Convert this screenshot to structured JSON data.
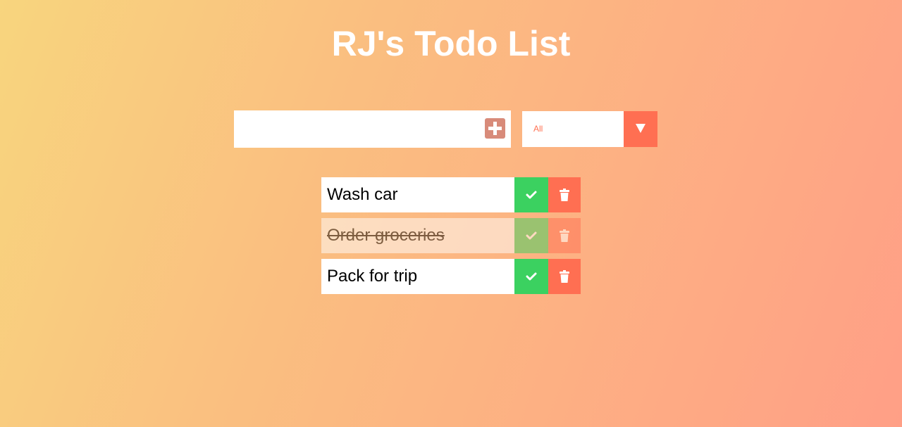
{
  "app": {
    "title": "RJ's Todo List"
  },
  "form": {
    "input_value": "",
    "add_icon": "plus-square-icon",
    "filter": {
      "selected": "All",
      "arrow_icon": "caret-down-icon"
    }
  },
  "todos": [
    {
      "text": "Wash car",
      "completed": false
    },
    {
      "text": "Order groceries",
      "completed": true
    },
    {
      "text": "Pack for trip",
      "completed": false
    }
  ],
  "icons": {
    "complete": "check-icon",
    "delete": "trash-icon"
  },
  "colors": {
    "gradient_start": "#f8d57e",
    "gradient_end": "#ff9f86",
    "complete_green": "#3bd160",
    "delete_red": "#ff6f52",
    "add_button": "#d88b7a"
  }
}
